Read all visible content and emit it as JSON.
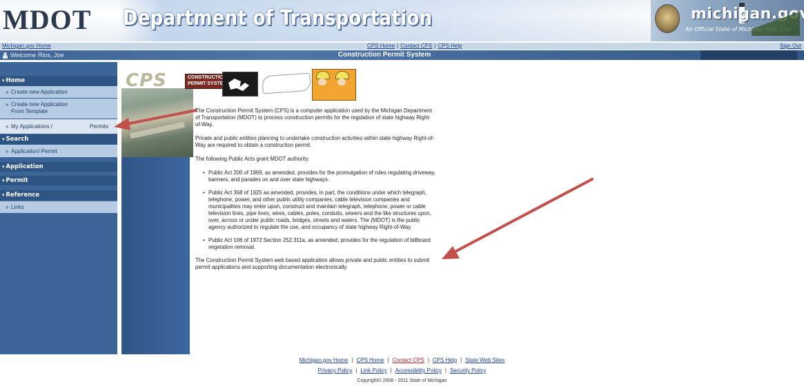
{
  "header": {
    "mdot_logo": "MDOT",
    "dept_title": "Department of Transportation",
    "michigan_logo": "michigan.gov",
    "michigan_tagline": "An Official State of Michigan Web Site"
  },
  "linkbar": {
    "michigan_home": "Michigan.gov Home",
    "cps_home": "CPS Home",
    "contact_cps": "Contact CPS",
    "cps_help": "CPS Help",
    "sep": "|",
    "sign_out": "Sign Out"
  },
  "titlebar": {
    "welcome": "Welcome Rios, Joe",
    "system_title": "Construction Permit System"
  },
  "sidebar": {
    "home": "Home",
    "create_new": "Create new Application",
    "create_template_1": "Create new Application",
    "create_template_2": "From Template",
    "my_applications": "My Applications /",
    "permits": "Permits",
    "search": "Search",
    "app_permit": "Application/ Permit",
    "application": "Application",
    "permit": "Permit",
    "reference": "Reference",
    "links": "Links",
    "bullet": "»",
    "triangle": "▾"
  },
  "hero": {
    "cps": "CPS",
    "label_line1": "CONSTRUCTION",
    "label_line2": "PERMIT SYSTEM"
  },
  "content": {
    "p1": "The Construction Permit System (CPS) is a computer application used by the Michigan Department of Transportation (MDOT) to process construction permits for the regulation of state highway Right-of-Way.",
    "p2": "Private and public entities planning to undertake construction activities within state highway Right-of-Way are required to obtain a construction permit.",
    "p3": "The following Public Acts grant MDOT authority:",
    "acts": [
      "Public Act 200 of 1969, as amended, provides for the promulgation of rules regulating driveway, banners, and parades on and over state highways.",
      "Public Act 368 of 1925 as amended, provides, in part, the conditions under which telegraph, telephone, power, and other public utility companies, cable television companies and municipalities may enter upon, construct and maintain telegraph, telephone, power or cable television lines, pipe lines, wires, cables, poles, conduits, sewers and the like structures upon, over, across or under public roads, bridges, streets and waters.  The (MDOT) is the public agency authorized to regulate the use, and occupancy of state highway Right-of-Way.",
      "Public Act 106 of 1972 Section 252.311a, as amended, provides for the regulation of billboard vegetation removal."
    ],
    "p4": "The Construction Permit System web based application allows private and public entities to submit permit applications and supporting documentation electronically.",
    "bullet": "•"
  },
  "footer": {
    "michigan_home": "Michigan.gov Home",
    "cps_home": "CPS Home",
    "contact_cps": "Contact CPS",
    "cps_help": "CPS Help",
    "state_web_sites": "State Web Sites",
    "privacy": "Privacy Policy",
    "link_policy": "Link Policy",
    "accessibility": "Accessibility Policy",
    "security": "Security Policy",
    "copyright": "Copyright© 2008 - 2011 State of Michigan",
    "sep": "|"
  },
  "colors": {
    "annotation_arrow": "#c0504d",
    "sidebar_bg": "#3c6597",
    "link": "#1c3f8a"
  }
}
